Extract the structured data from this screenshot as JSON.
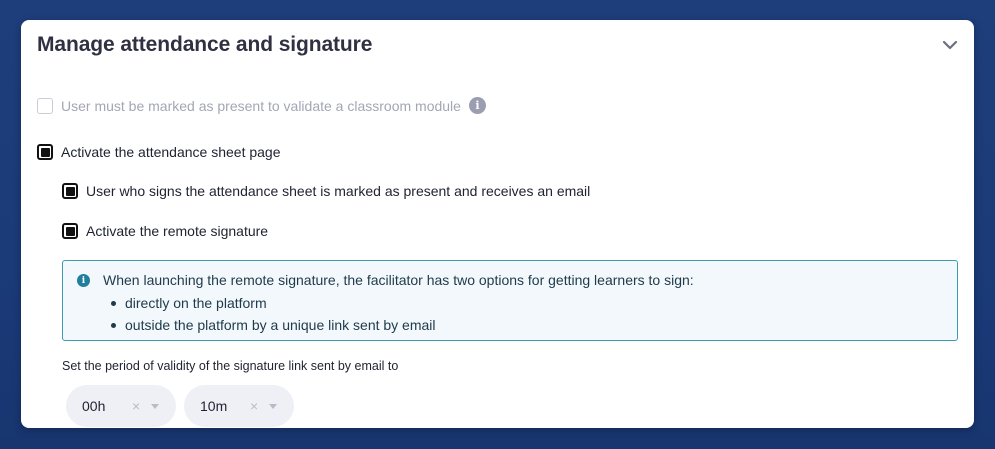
{
  "panel": {
    "title": "Manage attendance and signature",
    "collapse_icon": "chevron-down-icon"
  },
  "options": {
    "must_be_present": {
      "label": "User must be marked as present to validate a classroom module",
      "checked": false,
      "disabled": true,
      "info_icon": "info-icon"
    },
    "attendance_sheet": {
      "label": "Activate the attendance sheet page",
      "checked": true
    },
    "signs_marked_present": {
      "label": "User who signs the attendance sheet is marked as present and receives an email",
      "checked": true
    },
    "remote_signature": {
      "label": "Activate the remote signature",
      "checked": true
    }
  },
  "callout": {
    "icon": "info-icon",
    "text": "When launching the remote signature, the facilitator has two options for getting learners to sign:",
    "items": [
      "directly on the platform",
      "outside the platform by a unique link sent by email"
    ]
  },
  "validity": {
    "label": "Set the period of validity of the signature link sent by email to",
    "hours": "00h",
    "minutes": "10m",
    "clear_glyph": "×"
  },
  "colors": {
    "background": "#1e3d7b",
    "callout_border": "#3f9bb3",
    "info_accent": "#1f7f9d"
  }
}
